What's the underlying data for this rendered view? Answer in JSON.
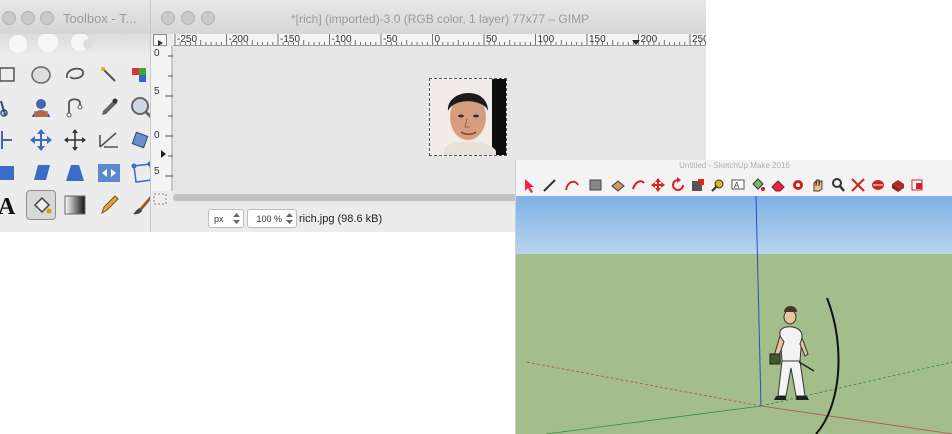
{
  "toolbox": {
    "title": "Toolbox - T..."
  },
  "image_window": {
    "title": "*[rich] (imported)-3.0 (RGB color, 1 layer) 77x77 – GIMP",
    "ruler_labels": [
      "-250",
      "-200",
      "-150",
      "-100",
      "-50",
      "0",
      "50",
      "100",
      "150",
      "200",
      "250"
    ],
    "vruler_labels": [
      "0",
      "5",
      "0",
      "5"
    ],
    "unit": "px",
    "zoom": "100 %",
    "file_info": "rich.jpg (98.6 kB)"
  },
  "sketchup": {
    "title": "Untitled - SketchUp Make 2016",
    "colors": {
      "sky": "#9ec4ec",
      "ground": "#a3bd8b"
    }
  }
}
